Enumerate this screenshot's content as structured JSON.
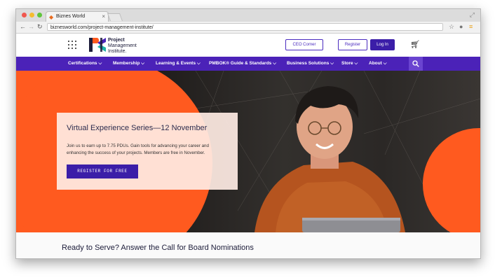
{
  "browser": {
    "tab_title": "Biznes World",
    "tab_close": "×",
    "url": "biznesworld.com/project-management-institute/"
  },
  "header": {
    "brand_line1": "Project",
    "brand_line2": "Management",
    "brand_line3": "Institute.",
    "ceo_corner": "CEO Corner",
    "register": "Register",
    "login": "Log In"
  },
  "nav": {
    "items": [
      {
        "label": "Certifications ⌵"
      },
      {
        "label": "Membership ⌵"
      },
      {
        "label": "Learning & Events ⌵"
      },
      {
        "label": "PMBOK® Guide & Standards ⌵"
      },
      {
        "label": "Business Solutions ⌵"
      },
      {
        "label": "Store ⌵"
      },
      {
        "label": "About ⌵"
      }
    ]
  },
  "hero": {
    "title": "Virtual Experience Series—12 November",
    "text": "Join us to earn up to 7.75 PDUs. Gain tools for advancing your career and enhancing the success of your projects. Members are free in November.",
    "cta": "REGISTER FOR FREE"
  },
  "section": {
    "headline": "Ready to Serve? Answer the Call for Board Nominations"
  },
  "colors": {
    "brand_purple": "#4b22b8",
    "hero_orange": "#ff5a1f"
  },
  "icons": [
    "back-arrow-icon",
    "forward-arrow-icon",
    "reload-icon",
    "star-icon",
    "mic-icon",
    "menu-icon",
    "grid-icon",
    "cart-icon",
    "search-icon"
  ]
}
